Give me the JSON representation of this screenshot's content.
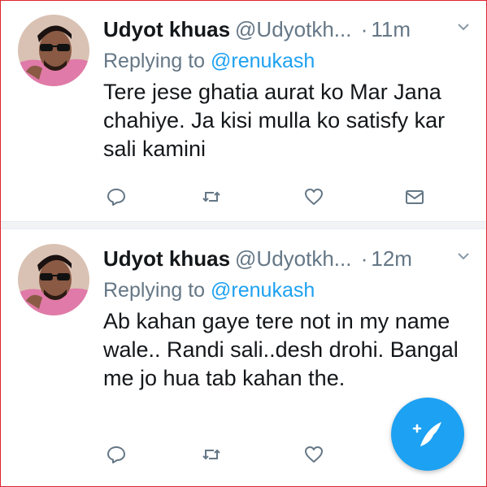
{
  "tweets": [
    {
      "name": "Udyot khuas",
      "handle": "@Udyotkh...",
      "separator": "·",
      "time": "11m",
      "replying_prefix": "Replying to",
      "replying_to": "@renukash",
      "text": "Tere jese ghatia aurat ko Mar Jana chahiye. Ja kisi mulla ko satisfy kar sali kamini"
    },
    {
      "name": "Udyot khuas",
      "handle": "@Udyotkh...",
      "separator": "·",
      "time": "12m",
      "replying_prefix": "Replying to",
      "replying_to": "@renukash",
      "text": "Ab kahan gaye tere not in my name wale.. Randi sali..desh drohi. Bangal me jo hua tab kahan the."
    }
  ],
  "icons": {
    "reply": "reply-icon",
    "retweet": "retweet-icon",
    "like": "heart-icon",
    "message": "envelope-icon",
    "menu": "chevron-down-icon",
    "compose": "compose-tweet-icon"
  },
  "colors": {
    "accent": "#1da1f2",
    "text": "#14171a",
    "secondary": "#657786",
    "border": "#e0242e"
  }
}
